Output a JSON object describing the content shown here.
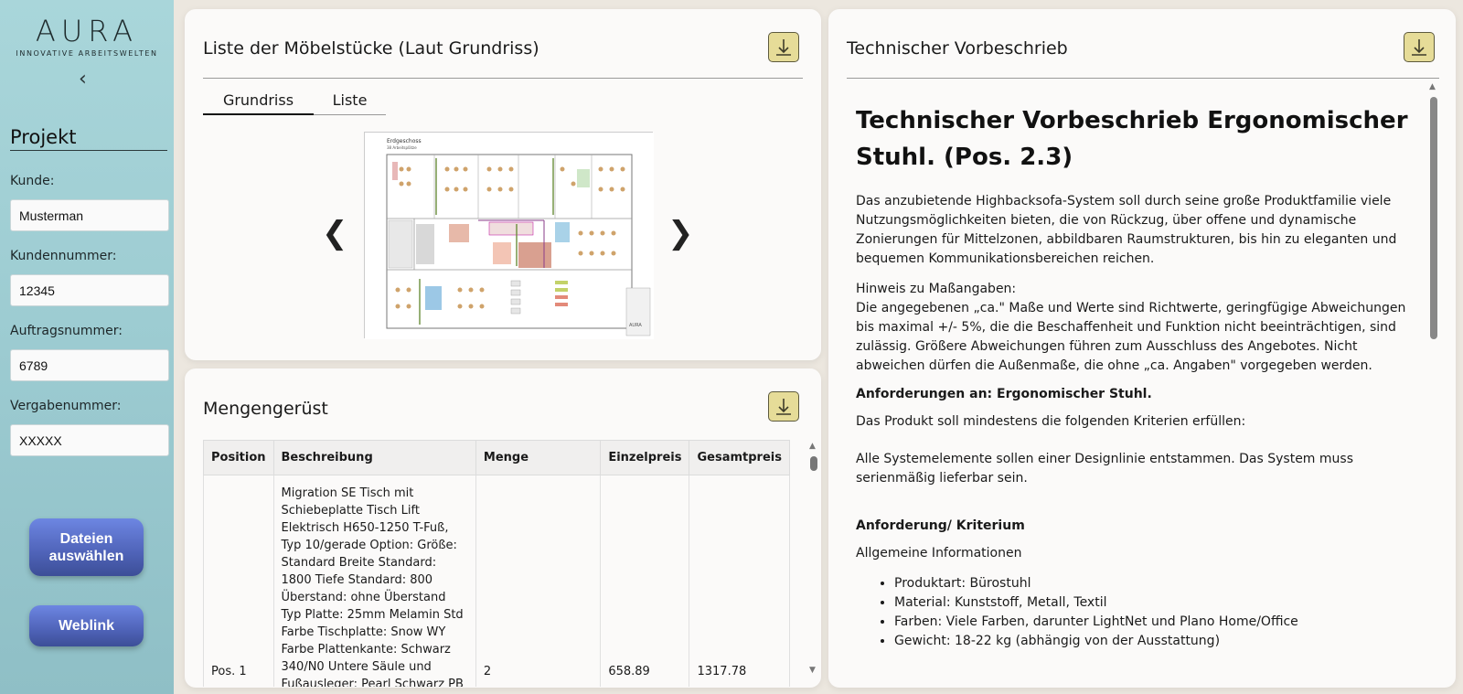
{
  "sidebar": {
    "logo_word": "AURA",
    "logo_tagline": "INNOVATIVE ARBEITSWELTEN",
    "collapse_glyph": "‹",
    "project_title": "Projekt",
    "fields": [
      {
        "label": "Kunde:",
        "value": "Musterman"
      },
      {
        "label": "Kundennummer:",
        "value": "12345"
      },
      {
        "label": "Auftragsnummer:",
        "value": "6789"
      },
      {
        "label": "Vergabenummer:",
        "value": "XXXXX"
      }
    ],
    "btn_files": "Dateien auswählen",
    "btn_weblink": "Weblink"
  },
  "furniture": {
    "title": "Liste der Möbelstücke (Laut Grundriss)",
    "tabs": [
      "Grundriss",
      "Liste"
    ],
    "active_tab": "Grundriss",
    "prev": "❮",
    "next": "❯",
    "plan_heading": "Erdgeschoss",
    "plan_sub": "38 Arbeitsplätze",
    "plan_logo": "AURA"
  },
  "quantities": {
    "title": "Mengengerüst",
    "columns": [
      "Position",
      "Beschreibung",
      "Menge",
      "Einzelpreis",
      "Gesamtpreis"
    ],
    "rows": [
      {
        "position": "Pos. 1",
        "description": "Migration SE Tisch mit Schiebeplatte Tisch Lift Elektrisch H650-1250 T-Fuß, Typ 10/gerade Option: Größe: Standard Breite Standard: 1800 Tiefe Standard: 800 Überstand: ohne Überstand Typ Platte: 25mm Melamin Std Farbe Tischplatte: Snow WY Farbe Plattenkante: Schwarz 340/N0 Untere Säule und Fußausleger: Pearl Schwarz PB Innere Säule(n): Pearl",
        "qty": "2",
        "unit_price": "658.89",
        "total_price": "1317.78"
      }
    ]
  },
  "technical": {
    "title": "Technischer Vorbeschrieb",
    "heading": "Technischer Vorbeschrieb Ergonomischer Stuhl. (Pos. 2.3)",
    "intro": "Das anzubietende Highbacksofa-System soll durch seine große Produktfamilie viele Nutzungsmöglichkeiten bieten, die von Rückzug, über offene und dynamische Zonierungen für Mittelzonen, abbildbaren Raumstrukturen, bis hin zu eleganten und bequemen Kommunikationsbereichen reichen.",
    "note_label": "Hinweis zu Maßangaben:",
    "note_text": "Die angegebenen „ca.\" Maße und Werte sind Richtwerte, geringfügige Abweichungen bis maximal +/- 5%, die die Beschaffenheit und Funktion nicht beeinträchtigen, sind zulässig. Größere Abweichungen führen zum Ausschluss des Angebotes. Nicht abweichen dürfen die Außenmaße, die ohne „ca. Angaben\" vorgegeben werden.",
    "req_heading": "Anforderungen an: Ergonomischer Stuhl.",
    "req_intro": "Das Produkt soll mindestens die folgenden Kriterien erfüllen:",
    "req_text": "Alle Systemelemente sollen einer Designlinie entstammen. Das System muss serienmäßig lieferbar sein.",
    "criteria_heading": "Anforderung/ Kriterium",
    "general_info": "Allgemeine Informationen",
    "features": [
      "Produktart: Bürostuhl",
      "Material: Kunststoff, Metall, Textil",
      "Farben: Viele Farben, darunter LightNet und Plano Home/Office",
      "Gewicht: 18-22 kg (abhängig von der Ausstattung)"
    ]
  },
  "colors": {
    "sidebar_top": "#a9d6da",
    "button_blue": "#5a6fcc",
    "download_yellow": "#e6dc98",
    "background": "#ece7df"
  },
  "icons": {
    "download": "download-arrow-icon",
    "collapse": "chevron-left-icon"
  }
}
